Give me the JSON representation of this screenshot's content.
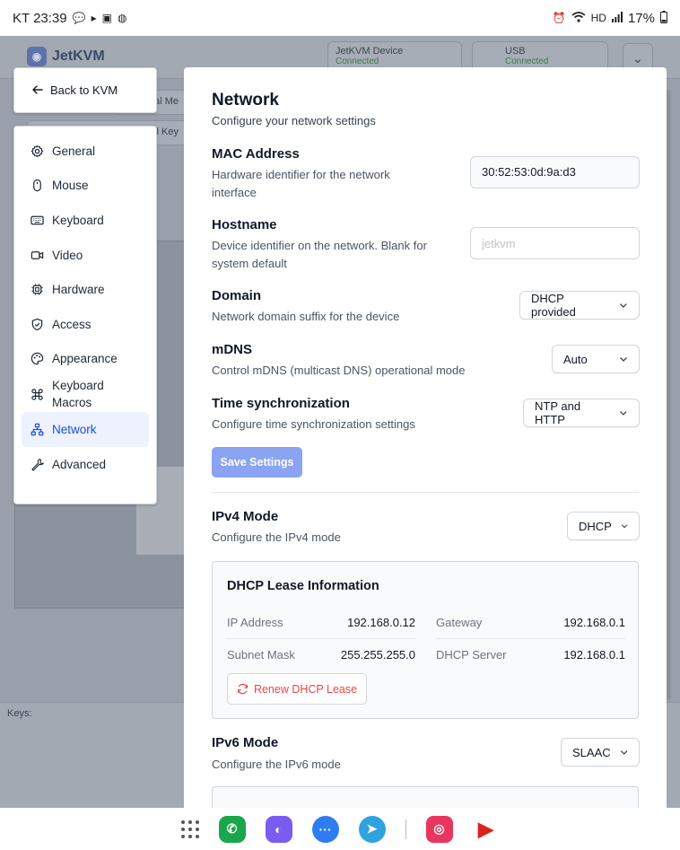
{
  "status_bar": {
    "carrier_time": "KT 23:39",
    "battery": "17%"
  },
  "background": {
    "logo": "JetKVM",
    "device_card": {
      "title": "JetKVM Device",
      "sub": "Connected"
    },
    "usb_card": {
      "title": "USB",
      "sub": "Connected"
    },
    "tab_partial_1": "al Me",
    "tab_partial_2": "al Key",
    "keys_label": "Keys:"
  },
  "back_button": {
    "label": "Back to KVM"
  },
  "sidebar": {
    "items": [
      {
        "label": "General",
        "icon": "gear-icon"
      },
      {
        "label": "Mouse",
        "icon": "mouse-icon"
      },
      {
        "label": "Keyboard",
        "icon": "keyboard-icon"
      },
      {
        "label": "Video",
        "icon": "video-icon"
      },
      {
        "label": "Hardware",
        "icon": "chip-icon"
      },
      {
        "label": "Access",
        "icon": "shield-icon"
      },
      {
        "label": "Appearance",
        "icon": "palette-icon"
      },
      {
        "label": "Keyboard Macros",
        "icon": "command-icon"
      },
      {
        "label": "Network",
        "icon": "network-icon",
        "active": true
      },
      {
        "label": "Advanced",
        "icon": "wrench-icon"
      }
    ]
  },
  "network": {
    "title": "Network",
    "subtitle": "Configure your network settings",
    "mac": {
      "label": "MAC Address",
      "desc": "Hardware identifier for the network interface",
      "value": "30:52:53:0d:9a:d3"
    },
    "hostname": {
      "label": "Hostname",
      "desc": "Device identifier on the network. Blank for system default",
      "placeholder": "jetkvm"
    },
    "domain": {
      "label": "Domain",
      "desc": "Network domain suffix for the device",
      "selected": "DHCP provided"
    },
    "mdns": {
      "label": "mDNS",
      "desc": "Control mDNS (multicast DNS) operational mode",
      "selected": "Auto"
    },
    "timesync": {
      "label": "Time synchronization",
      "desc": "Configure time synchronization settings",
      "selected": "NTP and HTTP"
    },
    "save_label": "Save Settings",
    "ipv4": {
      "label": "IPv4 Mode",
      "desc": "Configure the IPv4 mode",
      "selected": "DHCP"
    },
    "lease": {
      "title": "DHCP Lease Information",
      "ip_label": "IP Address",
      "ip_value": "192.168.0.12",
      "gateway_label": "Gateway",
      "gateway_value": "192.168.0.1",
      "mask_label": "Subnet Mask",
      "mask_value": "255.255.255.0",
      "server_label": "DHCP Server",
      "server_value": "192.168.0.1",
      "renew_label": "Renew DHCP Lease"
    },
    "ipv6": {
      "label": "IPv6 Mode",
      "desc": "Configure the IPv6 mode",
      "selected": "SLAAC"
    }
  },
  "colors": {
    "accent": "#1d4ed8",
    "save_button": "#8ba3f3",
    "renew_text": "#ef4444"
  }
}
